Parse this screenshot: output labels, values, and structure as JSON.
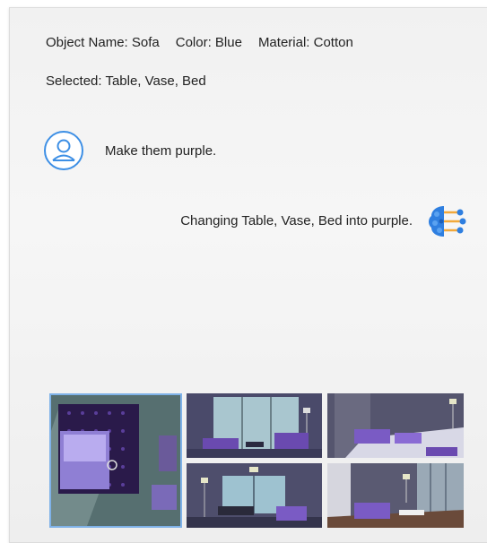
{
  "info": {
    "object_name": "Object Name: Sofa",
    "color": "Color: Blue",
    "material": "Material: Cotton",
    "selected": "Selected: Table, Vase, Bed"
  },
  "chat": {
    "user_message": "Make them purple.",
    "assistant_message": "Changing Table, Vase, Bed into purple."
  },
  "icons": {
    "user": "user-avatar-icon",
    "assistant": "ai-brain-icon"
  },
  "colors": {
    "accent_blue": "#3d8fe5",
    "ai_orange": "#f2a93b",
    "purple": "#7a5bc4"
  }
}
